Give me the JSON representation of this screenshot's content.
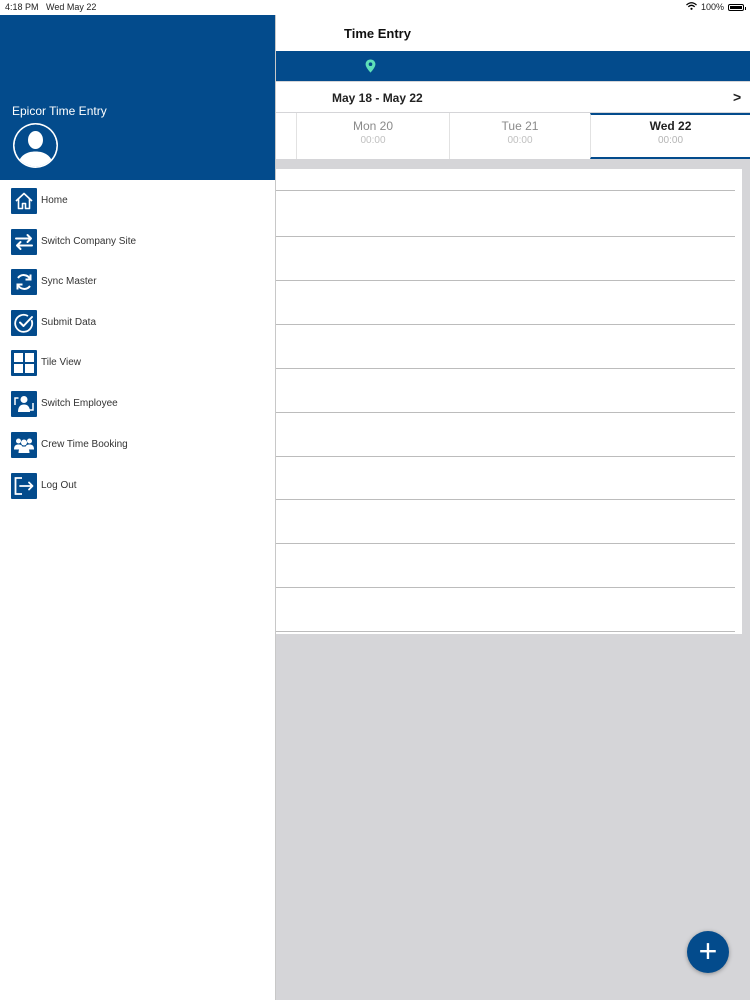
{
  "status_bar": {
    "time": "4:18 PM",
    "date": "Wed May 22",
    "battery": "100%"
  },
  "nav": {
    "title": "Time Entry"
  },
  "week": {
    "range": "May 18 - May 22",
    "next": ">",
    "days": [
      {
        "name": "Mon  20",
        "hours": "00:00"
      },
      {
        "name": "Tue  21",
        "hours": "00:00"
      },
      {
        "name": "Wed  22",
        "hours": "00:00"
      }
    ],
    "active_day": "Wed  22"
  },
  "drawer": {
    "app_name": "Epicor Time Entry",
    "menu": [
      {
        "label": "Home",
        "icon": "home-icon"
      },
      {
        "label": "Switch Company Site",
        "icon": "switch-arrows-icon"
      },
      {
        "label": "Sync Master",
        "icon": "sync-icon"
      },
      {
        "label": "Submit Data",
        "icon": "check-circle-icon"
      },
      {
        "label": "Tile View",
        "icon": "tile-grid-icon"
      },
      {
        "label": "Switch Employee",
        "icon": "switch-employee-icon"
      },
      {
        "label": "Crew Time Booking",
        "icon": "crew-icon"
      },
      {
        "label": "Log Out",
        "icon": "logout-icon"
      }
    ]
  },
  "fab": {
    "label": "+"
  },
  "colors": {
    "brand": "#034b8c",
    "pin": "#5ee0b8",
    "background": "#d5d5d8"
  }
}
